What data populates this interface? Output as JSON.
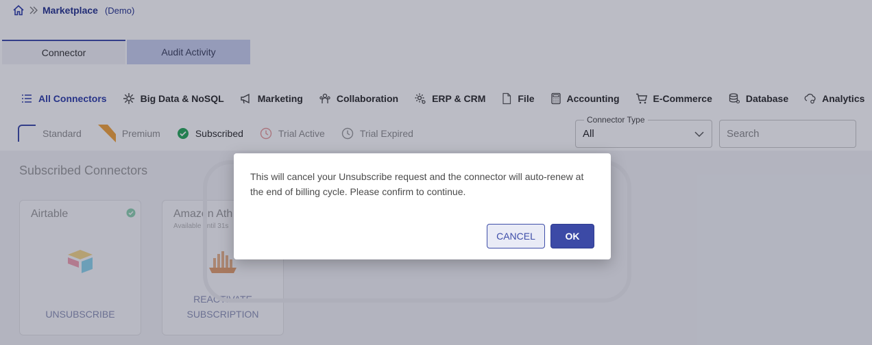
{
  "breadcrumb": {
    "title": "Marketplace",
    "subtitle": "(Demo)"
  },
  "tabs": [
    {
      "label": "Connector"
    },
    {
      "label": "Audit Activity"
    }
  ],
  "categories": [
    {
      "label": "All Connectors",
      "icon": "list-icon"
    },
    {
      "label": "Big Data & NoSQL",
      "icon": "bigdata-icon"
    },
    {
      "label": "Marketing",
      "icon": "megaphone-icon"
    },
    {
      "label": "Collaboration",
      "icon": "people-icon"
    },
    {
      "label": "ERP & CRM",
      "icon": "gear-icon"
    },
    {
      "label": "File",
      "icon": "file-icon"
    },
    {
      "label": "Accounting",
      "icon": "calculator-icon"
    },
    {
      "label": "E-Commerce",
      "icon": "cart-icon"
    },
    {
      "label": "Database",
      "icon": "database-icon"
    },
    {
      "label": "Analytics",
      "icon": "analytics-icon"
    }
  ],
  "legend": {
    "standard": "Standard",
    "premium": "Premium",
    "subscribed": "Subscribed",
    "trial_active": "Trial Active",
    "trial_expired": "Trial Expired"
  },
  "filters": {
    "connector_type_label": "Connector Type",
    "connector_type_value": "All",
    "search_placeholder": "Search"
  },
  "section": {
    "title": "Subscribed Connectors"
  },
  "cards": [
    {
      "name": "Airtable",
      "subtitle": "",
      "action": "UNSUBSCRIBE"
    },
    {
      "name": "Amazon Ath",
      "subtitle": "Available until 31s",
      "action_line1": "REACTIVATE",
      "action_line2": "SUBSCRIPTION"
    }
  ],
  "dialog": {
    "message": "This will cancel your Unsubscribe request and the connector will auto-renew at the end of billing cycle. Please confirm to continue.",
    "cancel_label": "CANCEL",
    "ok_label": "OK"
  },
  "colors": {
    "accent": "#3c4aa6",
    "subscribed_green": "#27a85a",
    "overlay": "rgba(30,34,64,0.30)"
  }
}
